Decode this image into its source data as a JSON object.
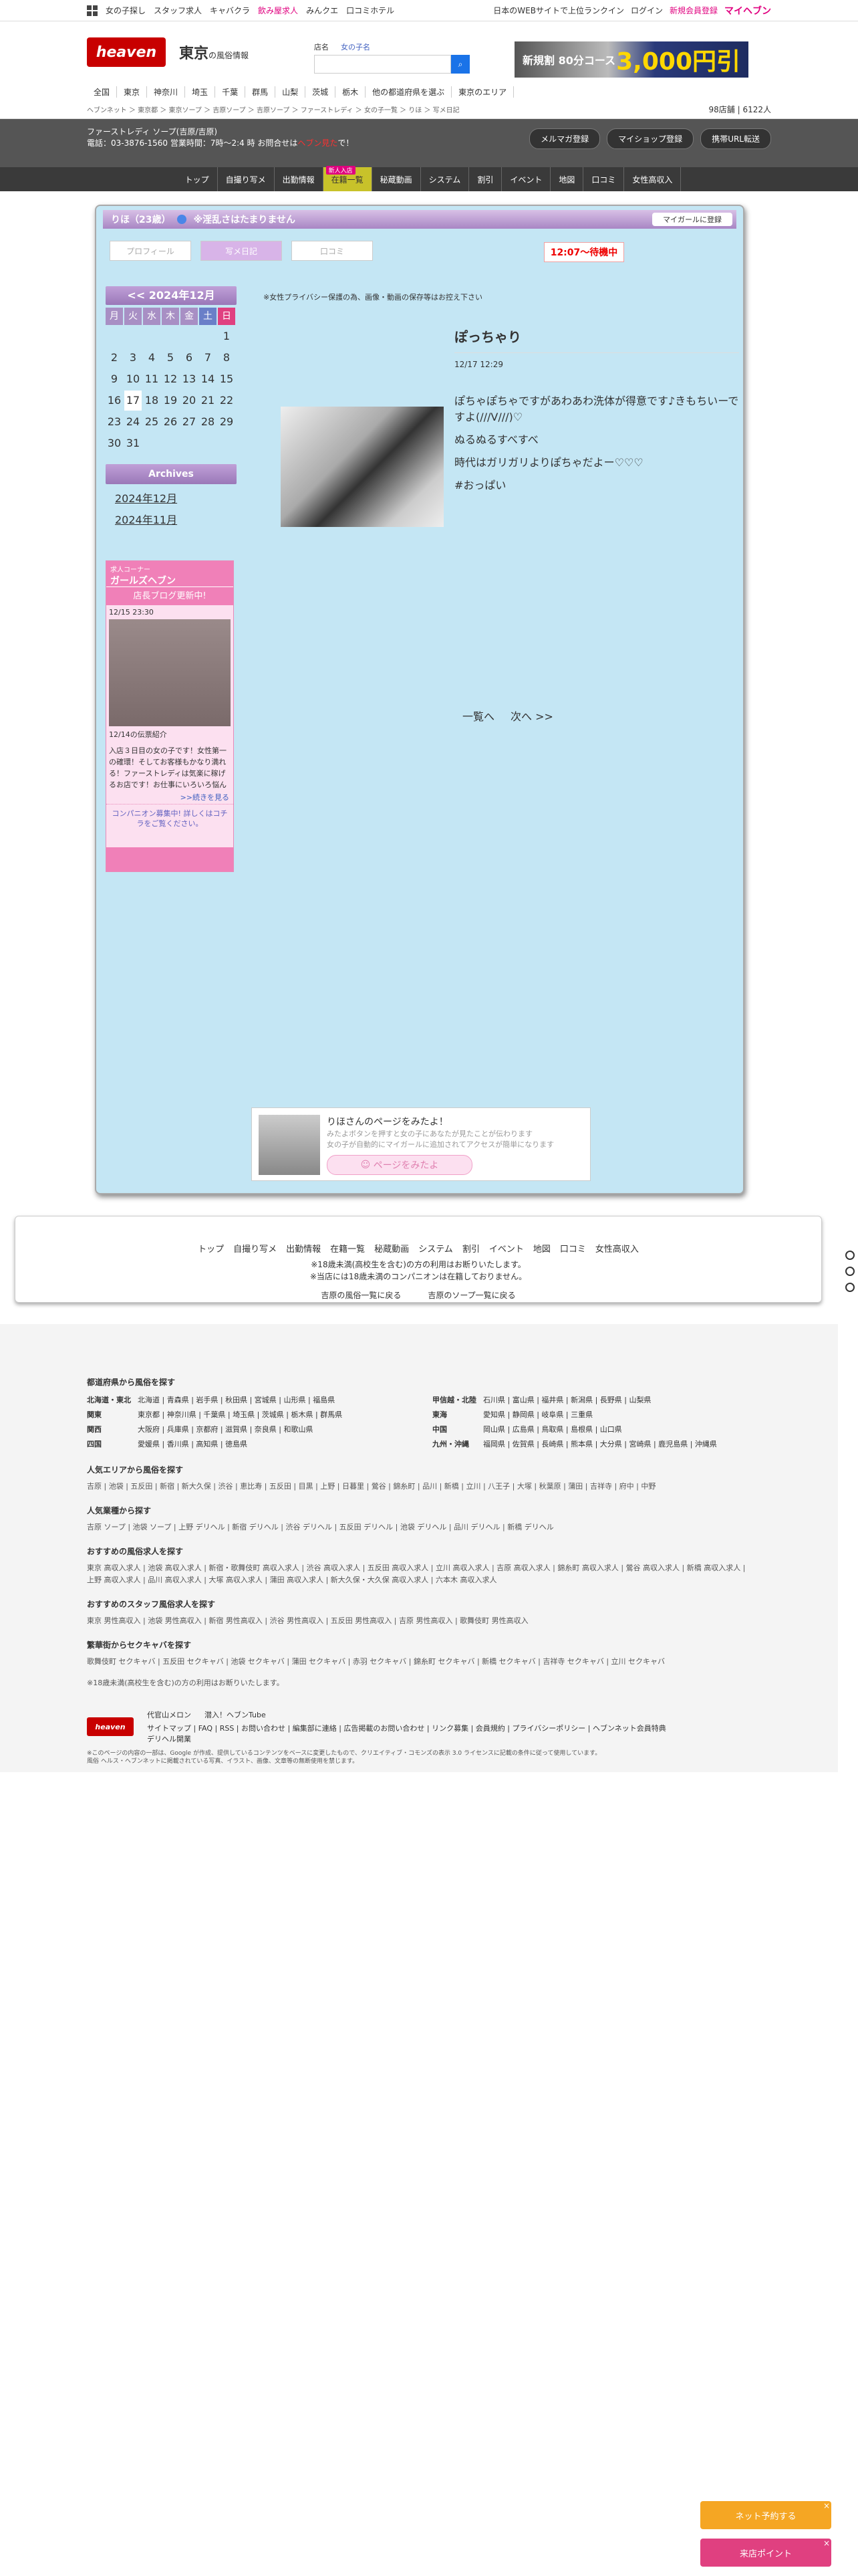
{
  "topbar": {
    "left": [
      "女の子探し",
      "スタッフ求人",
      "キャバクラ",
      "飲み屋求人",
      "みんクエ",
      "口コミホテル"
    ],
    "right_text": "日本のWEBサイトで上位ランクイン",
    "login": "ログイン",
    "register": "新規会員登録",
    "myheaven": "マイヘブン"
  },
  "header": {
    "logo": "heaven",
    "region": "東京",
    "region_sub": "の風俗情報",
    "search_label": "店名",
    "search_label2": "女の子名",
    "banner_left": "新規割 80分コース",
    "banner_right": "3,000円引"
  },
  "nav": [
    "全国",
    "東京",
    "神奈川",
    "埼玉",
    "千葉",
    "群馬",
    "山梨",
    "茨城",
    "栃木",
    "他の都道府県を選ぶ",
    "東京のエリア"
  ],
  "breadcrumb": {
    "path": "ヘブンネット ＞ 東京都 ＞ 東京ソープ ＞ 吉原ソープ ＞ 吉原ソープ ＞ ファーストレディ ＞ 女の子一覧 ＞ りほ ＞ 写メ日記",
    "count_label": "98店舗",
    "count2": "6122人"
  },
  "shop": {
    "name": "ファーストレディ ソープ(吉原/吉原)",
    "tel": "電話：03-3876-1560 営業時間：7時〜2:4 時 お問合せは",
    "tel_red": "ヘブン見た",
    "tel_end": "で！",
    "buttons": [
      "メルマガ登録",
      "マイショップ登録",
      "携帯URL転送"
    ]
  },
  "menu": [
    "トップ",
    "自撮り写メ",
    "出勤情報",
    "在籍一覧",
    "秘蔵動画",
    "システム",
    "割引",
    "イベント",
    "地図",
    "口コミ",
    "女性高収入"
  ],
  "menu_new": "新人入店",
  "girl": {
    "title": "りほ（23歳）",
    "tag": "※淫乱さはたまりません",
    "mygirl": "マイガールに登録",
    "tabs": [
      "プロフィール",
      "写メ日記",
      "口コミ"
    ],
    "status": "12:07〜待機中"
  },
  "calendar": {
    "header": "<< 2024年12月",
    "weekdays": [
      "月",
      "火",
      "水",
      "木",
      "金",
      "土",
      "日"
    ],
    "days": [
      "",
      "",
      "",
      "",
      "",
      "",
      "1",
      "2",
      "3",
      "4",
      "5",
      "6",
      "7",
      "8",
      "9",
      "10",
      "11",
      "12",
      "13",
      "14",
      "15",
      "16",
      "17",
      "18",
      "19",
      "20",
      "21",
      "22",
      "23",
      "24",
      "25",
      "26",
      "27",
      "28",
      "29",
      "30",
      "31"
    ]
  },
  "archives": {
    "title": "Archives",
    "links": [
      "2024年12月",
      "2024年11月"
    ]
  },
  "blogbox": {
    "label": "求人コーナー",
    "title": "ガールズヘブン",
    "sub": "店長ブログ更新中!",
    "date": "12/15 23:30",
    "post_title": "12/14の伝票紹介",
    "text": "入店３日目の女の子です！女性第一の確環！そしてお客様もかなり満れる！ファーストレディは気楽に稼げるお店です！お仕事にいろいろ悩んでいる女性",
    "more": ">>続きを見る",
    "conc": "コンパニオン募集中! 詳しくはコチラをご覧ください。"
  },
  "notice": "※女性プライバシー保護の為、画像・動画の保存等はお控え下さい",
  "post": {
    "title": "ぽっちゃり",
    "datetime": "12/17 12:29",
    "lines": [
      "ぽちゃぽちゃですがあわあわ洗体が得意です♪きもちいーですよ(///V///)♡",
      "ぬるぬるすべすべ",
      "時代はガリガリよりぽちゃだよー♡♡♡",
      "#おっぱい"
    ]
  },
  "pager": {
    "list": "一覧へ",
    "next": "次へ >>"
  },
  "invite": {
    "title": "りほさんのページをみたよ！",
    "gray1": "みたよボタンを押すと女の子にあなたが見たことが伝わります",
    "gray2": "女の子が自動的にマイガールに追加されてアクセスが簡単になります",
    "btn": "ページをみたよ"
  },
  "footnav": {
    "links": [
      "トップ",
      "自撮り写メ",
      "出勤情報",
      "在籍一覧",
      "秘蔵動画",
      "システム",
      "割引",
      "イベント",
      "地図",
      "口コミ",
      "女性高収入"
    ],
    "note1": "※18歳未満(高校生を含む)の方の利用はお断りいたします。",
    "note2": "※当店には18歳未満のコンパニオンは在籍しておりません。",
    "back1": "吉原の風俗一覧に戻る",
    "back2": "吉原のソープ一覧に戻る"
  },
  "footer": {
    "pref_title": "都道府県から風俗を探す",
    "prefs": [
      {
        "region": "北海道・東北",
        "items": "北海道 | 青森県 | 岩手県 | 秋田県 | 宮城県 | 山形県 | 福島県"
      },
      {
        "region": "甲信越・北陸",
        "items": "石川県 | 富山県 | 福井県 | 新潟県 | 長野県 | 山梨県"
      },
      {
        "region": "関東",
        "items": "東京都 | 神奈川県 | 千葉県 | 埼玉県 | 茨城県 | 栃木県 | 群馬県"
      },
      {
        "region": "東海",
        "items": "愛知県 | 静岡県 | 岐阜県 | 三重県"
      },
      {
        "region": "関西",
        "items": "大阪府 | 兵庫県 | 京都府 | 滋賀県 | 奈良県 | 和歌山県"
      },
      {
        "region": "中国",
        "items": "岡山県 | 広島県 | 鳥取県 | 島根県 | 山口県"
      },
      {
        "region": "四国",
        "items": "愛媛県 | 香川県 | 高知県 | 徳島県"
      },
      {
        "region": "九州・沖縄",
        "items": "福岡県 | 佐賀県 | 長崎県 | 熊本県 | 大分県 | 宮崎県 | 鹿児島県 | 沖縄県"
      }
    ],
    "area_title": "人気エリアから風俗を探す",
    "area": "吉原 | 池袋 | 五反田 | 新宿 | 新大久保 | 渋谷 | 恵比寿 | 五反田 | 目黒 | 上野 | 日暮里 | 鶯谷 | 錦糸町 | 品川 | 新橋 | 立川 | 八王子 | 大塚 | 秋葉原 | 蒲田 | 吉祥寺 | 府中 | 中野",
    "genre_title": "人気業種から探す",
    "genre": "吉原 ソープ | 池袋 ソープ | 上野 デリヘル | 新宿 デリヘル | 渋谷 デリヘル | 五反田 デリヘル | 池袋 デリヘル | 品川 デリヘル | 新橋 デリヘル",
    "job_title": "おすすめの風俗求人を探す",
    "job": "東京 高収入求人 | 池袋 高収入求人 | 新宿・歌舞伎町 高収入求人 | 渋谷 高収入求人 | 五反田 高収入求人 | 立川 高収入求人 | 吉原 高収入求人 | 錦糸町 高収入求人 | 鶯谷 高収入求人 | 新橋 高収入求人 | 上野 高収入求人 | 品川 高収入求人 | 大塚 高収入求人 | 蒲田 高収入求人 | 新大久保・大久保 高収入求人 | 六本木 高収入求人",
    "staff_title": "おすすめのスタッフ風俗求人を探す",
    "staff": "東京 男性高収入 | 池袋 男性高収入 | 新宿 男性高収入 | 渋谷 男性高収入 | 五反田 男性高収入 | 吉原 男性高収入 | 歌舞伎町 男性高収入",
    "caba_title": "繁華街からセクキャバを探す",
    "caba": "歌舞伎町 セクキャバ | 五反田 セクキャバ | 池袋 セクキャバ | 蒲田 セクキャバ | 赤羽 セクキャバ | 錦糸町 セクキャバ | 新橋 セクキャバ | 吉祥寺 セクキャバ | 立川 セクキャバ",
    "age_note": "※18歳未満(高校生を含む)の方の利用はお断りいたします。",
    "links": "サイトマップ | FAQ | RSS | お問い合わせ | 編集部に連絡 | 広告掲載のお問い合わせ | リンク募集 | 会員規約 | プライバシーポリシー | ヘブンネット会員特典",
    "link2": "デリヘル開業",
    "sns1": "代官山メロン",
    "sns2": "潜入！ヘブンTube",
    "copy": "※このページの内容の一部は、Google が作成、提供しているコンテンツをベースに変更したもので、クリエイティブ・コモンズの表示 3.0 ライセンスに記載の条件に従って使用しています。",
    "copy2": "風俗 ヘルス・ヘブンネットに掲載されている写真、イラスト、画像、文章等の無断使用を禁じます。"
  },
  "float": {
    "reserve": "ネット予約する",
    "point": "来店ポイント"
  }
}
